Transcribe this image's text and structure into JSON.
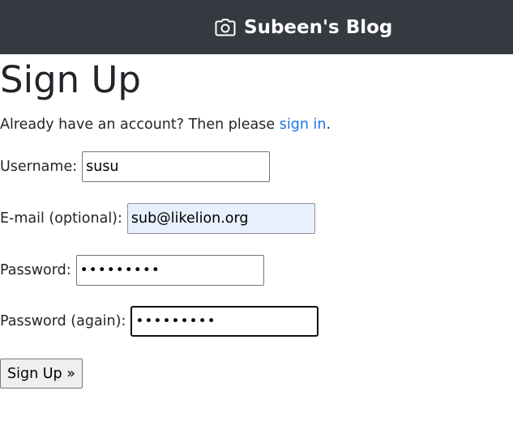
{
  "navbar": {
    "brand_icon": "camera-icon",
    "brand_text": "Subeen's Blog",
    "background": "#343a40"
  },
  "page": {
    "title": "Sign Up",
    "intro_prefix": "Already have an account? Then please ",
    "signin_link": "sign in",
    "intro_suffix": ".",
    "link_color": "#1a73e8"
  },
  "form": {
    "username_label": "Username:",
    "username_value": "susu",
    "email_label": "E-mail (optional):",
    "email_value": "sub@likelion.org",
    "password_label": "Password:",
    "password_value": "•••••••••",
    "password2_label": "Password (again):",
    "password2_value": "•••••••••",
    "submit_label": "Sign Up »"
  }
}
